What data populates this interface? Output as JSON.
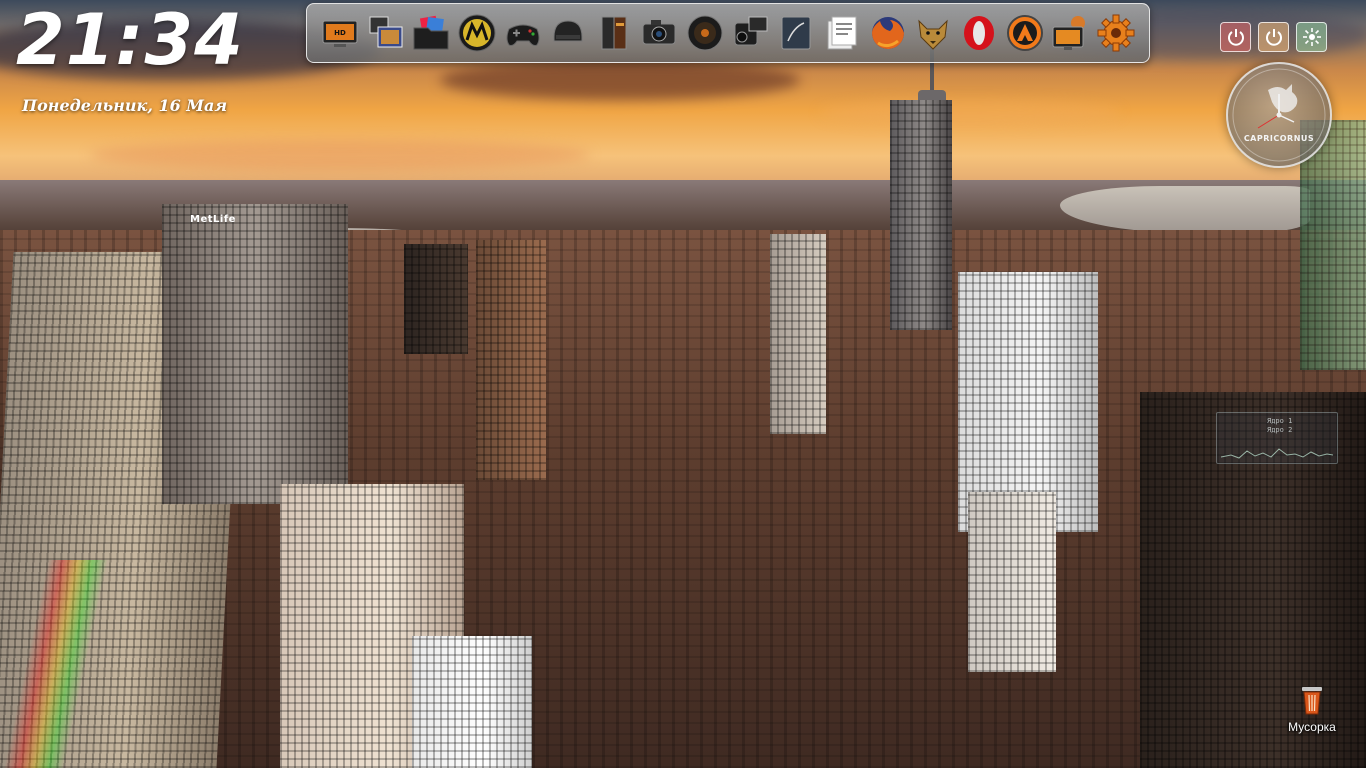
{
  "clock": {
    "time": "21:34",
    "date": "Понедельник, 16 Мая"
  },
  "wallpaper": {
    "building_sign": "MetLife"
  },
  "dock": {
    "items": [
      {
        "name": "harley-tv-icon"
      },
      {
        "name": "harley-gallery-icon"
      },
      {
        "name": "folder-photos-icon"
      },
      {
        "name": "motorola-icon"
      },
      {
        "name": "gamepad-icon"
      },
      {
        "name": "helmet-icon"
      },
      {
        "name": "books-icon"
      },
      {
        "name": "camera-icon"
      },
      {
        "name": "speaker-icon"
      },
      {
        "name": "video-camera-icon"
      },
      {
        "name": "notebook-icon"
      },
      {
        "name": "documents-icon"
      },
      {
        "name": "firefox-icon"
      },
      {
        "name": "wolf-icon"
      },
      {
        "name": "opera-icon"
      },
      {
        "name": "avast-icon"
      },
      {
        "name": "harley-monitor-icon"
      },
      {
        "name": "gear-icon"
      }
    ]
  },
  "power": {
    "colors": {
      "shutdown": "#e26666",
      "restart": "#f3ba7a",
      "settings": "#96d2a0"
    }
  },
  "zodiac": {
    "label": "CAPRICORNUS"
  },
  "monitor": {
    "line1": "Ядро 1",
    "line2": "Ядро 2"
  },
  "desktop": {
    "trash_label": "Мусорка"
  }
}
